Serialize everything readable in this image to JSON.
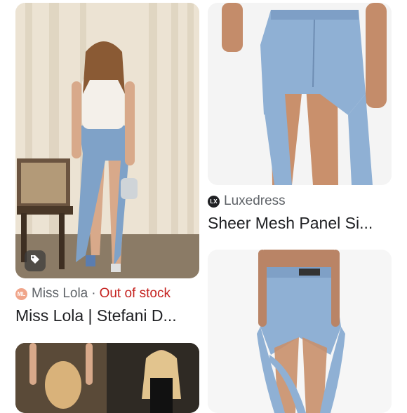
{
  "results": [
    {
      "source": "Miss Lola",
      "source_icon": "miss-lola-logo-icon",
      "separator": "·",
      "status": "Out of stock",
      "title": "Miss Lola | Stefani D..."
    },
    {
      "source": "Luxedress",
      "source_icon": "luxedress-logo-icon",
      "title": "Sheer Mesh Panel Si..."
    },
    {
      "source": "",
      "title": ""
    },
    {
      "source": "",
      "title": ""
    }
  ],
  "badges": {
    "product_tag_icon": "tag-icon"
  },
  "colors": {
    "out_of_stock": "#c5221f",
    "source_text": "#5f6368",
    "title_text": "#202124",
    "miss_lola_logo": "#f0a58a",
    "luxedress_logo": "#202124"
  }
}
